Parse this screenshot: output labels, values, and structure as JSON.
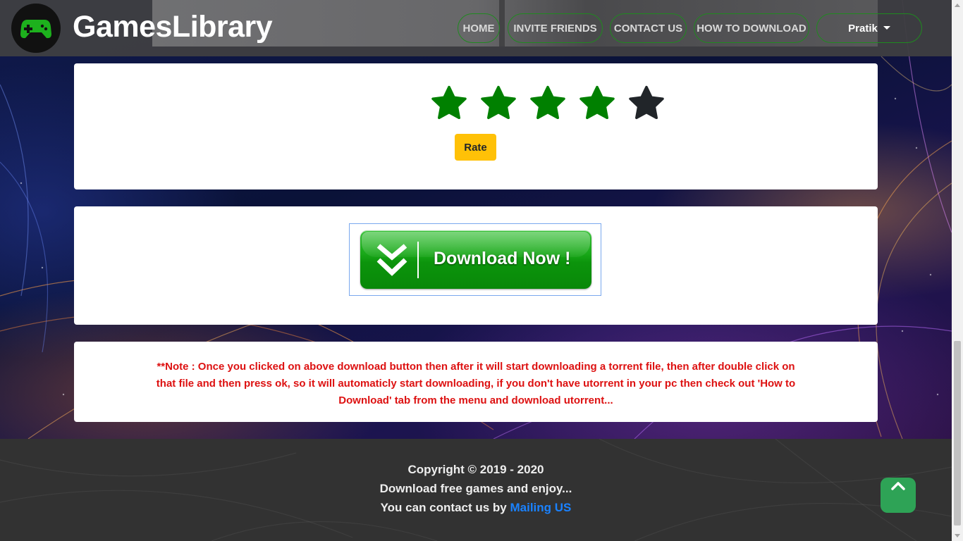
{
  "brand": {
    "name": "GamesLibrary",
    "logo_icon": "gamepad-icon"
  },
  "nav": {
    "items": [
      {
        "label": "HOME"
      },
      {
        "label": "INVITE FRIENDS"
      },
      {
        "label": "CONTACT US"
      },
      {
        "label": "HOW TO DOWNLOAD"
      }
    ],
    "user": "Pratik"
  },
  "rating": {
    "stars_total": 5,
    "stars_filled": 4,
    "filled_color": "#008000",
    "empty_color": "#212529",
    "button_label": "Rate"
  },
  "download": {
    "label": "Download  Now !",
    "icon": "double-chevron-down-icon"
  },
  "note": {
    "text": "**Note : Once you clicked on above download button then after it will start downloading a torrent file, then after double click on that file and then press ok, so it will automaticly start downloading, if you don't have utorrent in your pc then check out 'How to Download' tab from the menu and download utorrent..."
  },
  "footer": {
    "copyright": "Copyright © 2019 - 2020",
    "tagline": "Download free games and enjoy...",
    "contact_prefix": "You can contact us by",
    "contact_link": "Mailing US"
  },
  "colors": {
    "accent_green": "#008000",
    "rate_yellow": "#ffc107",
    "note_red": "#dd1111",
    "link_blue": "#1a82ff",
    "back_to_top": "#2ea356"
  },
  "back_to_top": {
    "icon": "chevron-up-icon"
  }
}
